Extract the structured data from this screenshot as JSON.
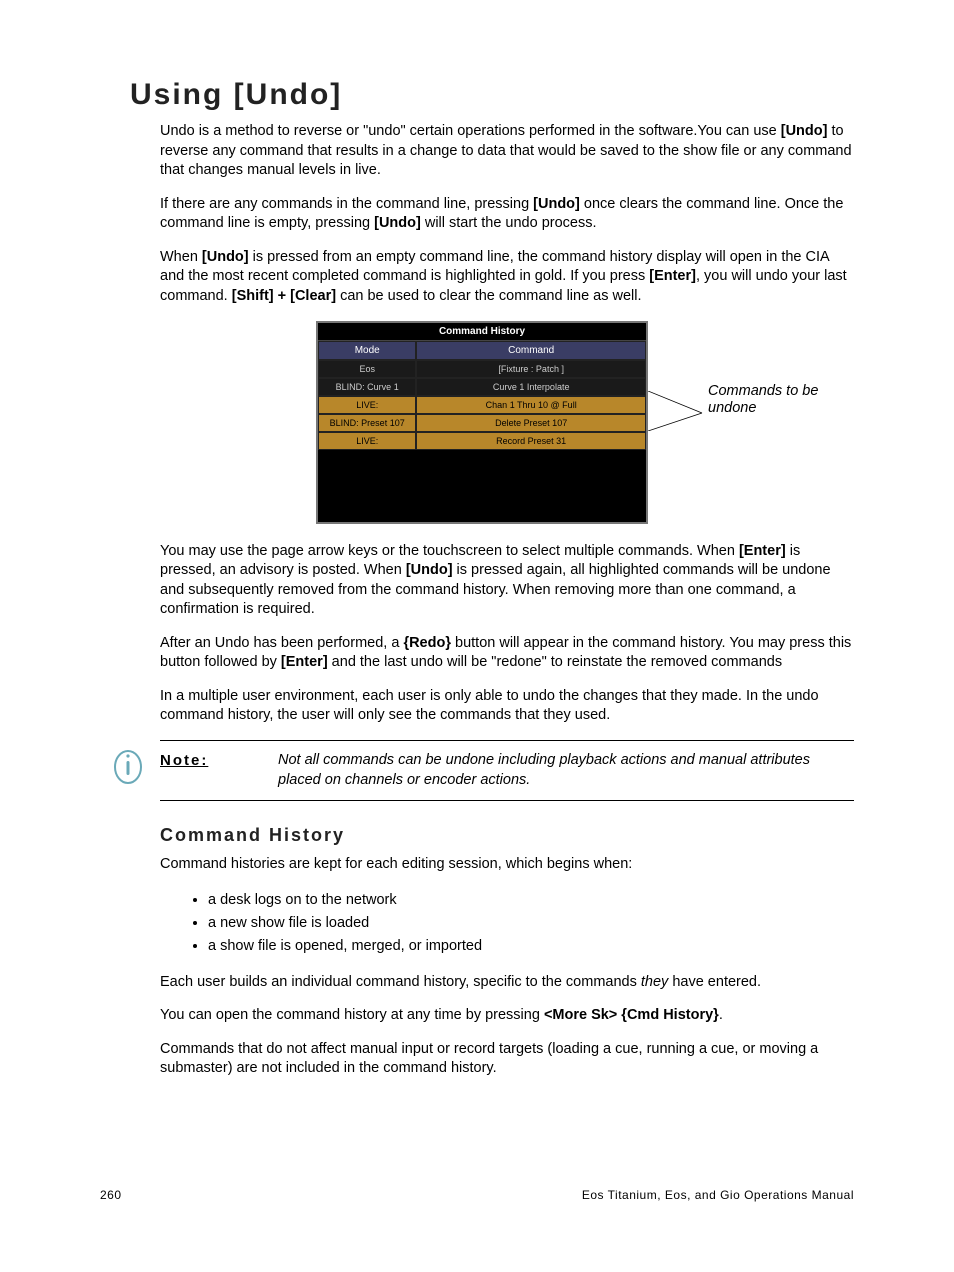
{
  "title": "Using [Undo]",
  "p1_a": "Undo is a method to reverse or \"undo\" certain operations performed in the software.You can use ",
  "p1_b": "[Undo]",
  "p1_c": " to reverse any command that results in a change to data that would be saved to the show file or any command that changes manual levels in live.",
  "p2_a": "If there are any commands in the command line, pressing ",
  "p2_b": "[Undo]",
  "p2_c": " once clears the command line. Once the command line is empty, pressing ",
  "p2_d": "[Undo]",
  "p2_e": " will start the undo process.",
  "p3_a": "When ",
  "p3_b": "[Undo]",
  "p3_c": " is pressed from an empty command line, the command history display will open in the CIA and the most recent completed command is highlighted in gold. If you press ",
  "p3_d": "[Enter]",
  "p3_e": ", you will undo your last command. ",
  "p3_f": "[Shift] + [Clear]",
  "p3_g": " can be used to clear the command line as well.",
  "table": {
    "title": "Command History",
    "hdr_mode": "Mode",
    "hdr_cmd": "Command",
    "rows": [
      {
        "mode": "Eos",
        "cmd": "[Fixture : Patch ]",
        "gold": false
      },
      {
        "mode": "BLIND: Curve  1",
        "cmd": "Curve 1 Interpolate",
        "gold": false
      },
      {
        "mode": "LIVE:",
        "cmd": "Chan 1 Thru 10 @ Full",
        "gold": true
      },
      {
        "mode": "BLIND: Preset  107",
        "cmd": "Delete Preset 107",
        "gold": true
      },
      {
        "mode": "LIVE:",
        "cmd": "Record Preset 31",
        "gold": true
      }
    ]
  },
  "annot": "Commands to be undone",
  "p4_a": "You may use the page arrow keys or the touchscreen to select multiple commands. When ",
  "p4_b": "[Enter]",
  "p4_c": " is pressed, an advisory is posted. When ",
  "p4_d": "[Undo]",
  "p4_e": " is pressed again, all highlighted commands will be undone and subsequently removed from the command history. When removing more than one command, a confirmation is required.",
  "p5_a": "After an Undo has been performed, a ",
  "p5_b": "{Redo}",
  "p5_c": " button will appear in the command history. You may press this button followed by ",
  "p5_d": "[Enter]",
  "p5_e": " and the last undo will be \"redone\" to reinstate the removed commands",
  "p6": "In a multiple user environment, each user is only able to undo the changes that they made. In the undo command history, the user will only see the commands that they used.",
  "note_label": "Note:",
  "note_text": "Not all commands can be undone including playback actions and manual attributes placed on channels or encoder actions.",
  "sub_title": "Command History",
  "p7": "Command histories are kept for each editing session, which begins when:",
  "bullets": [
    "a desk logs on to the network",
    "a new show file is loaded",
    "a show file is opened, merged, or imported"
  ],
  "p8_a": "Each user builds an individual command history, specific to the commands ",
  "p8_b": "they",
  "p8_c": " have entered.",
  "p9_a": "You can open the command history at any time by pressing ",
  "p9_b": "<More Sk> {Cmd History}",
  "p9_c": ".",
  "p10": "Commands that do not affect manual input or record targets (loading a cue, running a cue, or moving a submaster) are not included in the command history.",
  "footer_left": "260",
  "footer_right": "Eos Titanium, Eos, and Gio Operations Manual"
}
